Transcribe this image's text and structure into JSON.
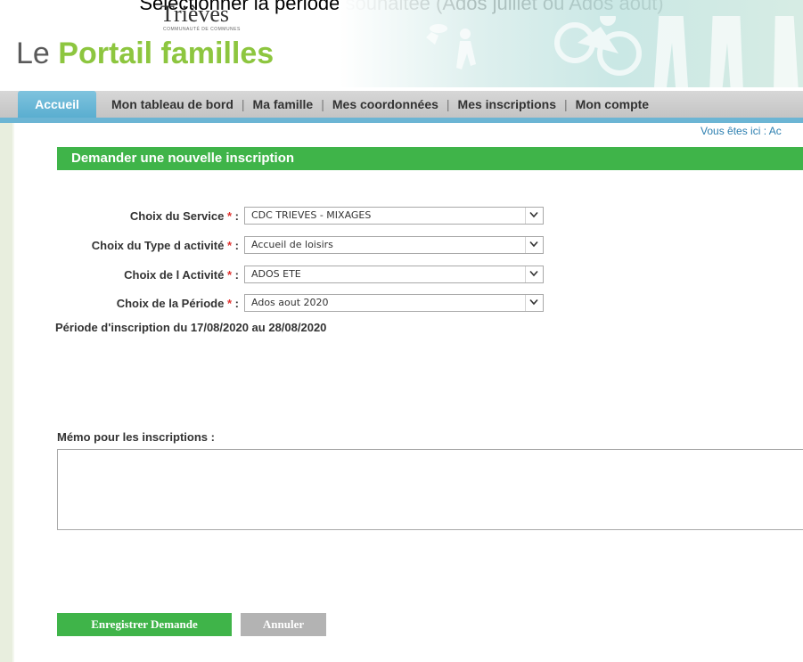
{
  "caption": "Sélectionner la période souhaitée (Ados juillet ou Ados aout)",
  "header": {
    "logo_small": "Trièves",
    "logo_small_sub": "COMMUNAUTÉ DE COMMUNES",
    "logo_prefix": "Le",
    "logo_brand": "Portail familles"
  },
  "nav": {
    "active": "Accueil",
    "items": [
      "Mon tableau de bord",
      "Ma famille",
      "Mes coordonnées",
      "Mes inscriptions",
      "Mon compte"
    ],
    "separator": "|"
  },
  "breadcrumb": "Vous êtes ici : Ac",
  "section_title": "Demander une nouvelle inscription",
  "form": {
    "required_mark": "*",
    "fields": [
      {
        "label": "Choix du Service",
        "suffix": " :",
        "value": "CDC TRIEVES - MIXAGES"
      },
      {
        "label": "Choix du Type d activité",
        "suffix": " :",
        "value": "Accueil de loisirs"
      },
      {
        "label": "Choix de l Activité",
        "suffix": " :",
        "value": "ADOS ETE"
      },
      {
        "label": "Choix de la Période",
        "suffix": " :",
        "value": "Ados aout 2020"
      }
    ],
    "period_info": "Période d'inscription du 17/08/2020 au 28/08/2020",
    "memo_label": "Mémo pour les inscriptions :",
    "memo_value": ""
  },
  "buttons": {
    "save": "Enregistrer Demande",
    "cancel": "Annuler"
  },
  "colors": {
    "brand_green": "#8dc63f",
    "section_green": "#3fb449",
    "nav_active_blue": "#5aaed0",
    "required_red": "#e0322f",
    "cancel_gray": "#b3b3b3"
  },
  "icons": [
    "chevron-down-icon"
  ]
}
